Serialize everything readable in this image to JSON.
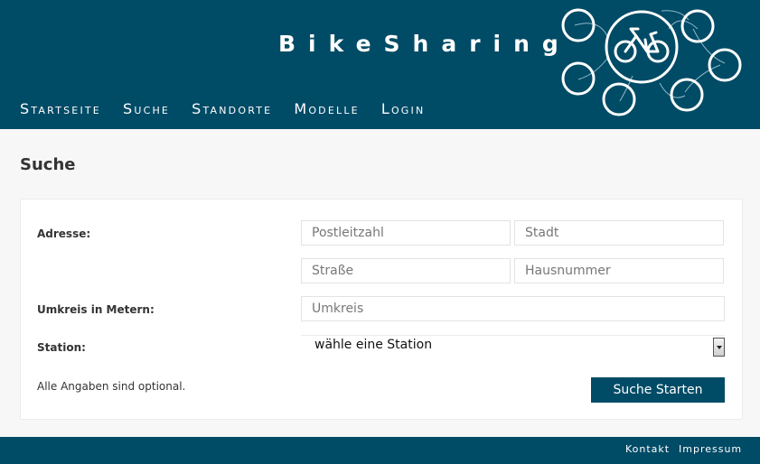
{
  "header": {
    "brand": "BikeSharing",
    "logo_icon": "bicycle-network-icon",
    "nav": [
      "Startseite",
      "Suche",
      "Standorte",
      "Modelle",
      "Login"
    ]
  },
  "page": {
    "title": "Suche"
  },
  "form": {
    "address_label": "Adresse:",
    "postal_code": {
      "placeholder": "Postleitzahl",
      "value": ""
    },
    "city": {
      "placeholder": "Stadt",
      "value": ""
    },
    "street": {
      "placeholder": "Straße",
      "value": ""
    },
    "house_number": {
      "placeholder": "Hausnummer",
      "value": ""
    },
    "radius_label": "Umkreis in Metern:",
    "radius": {
      "placeholder": "Umkreis",
      "value": ""
    },
    "station_label": "Station:",
    "station_selected": "wähle eine Station",
    "note": "Alle Angaben sind optional.",
    "submit_label": "Suche Starten"
  },
  "footer": {
    "links": [
      "Kontakt",
      "Impressum"
    ]
  },
  "colors": {
    "brand": "#004b66",
    "background": "#f7f7f7",
    "panel": "#ffffff"
  }
}
